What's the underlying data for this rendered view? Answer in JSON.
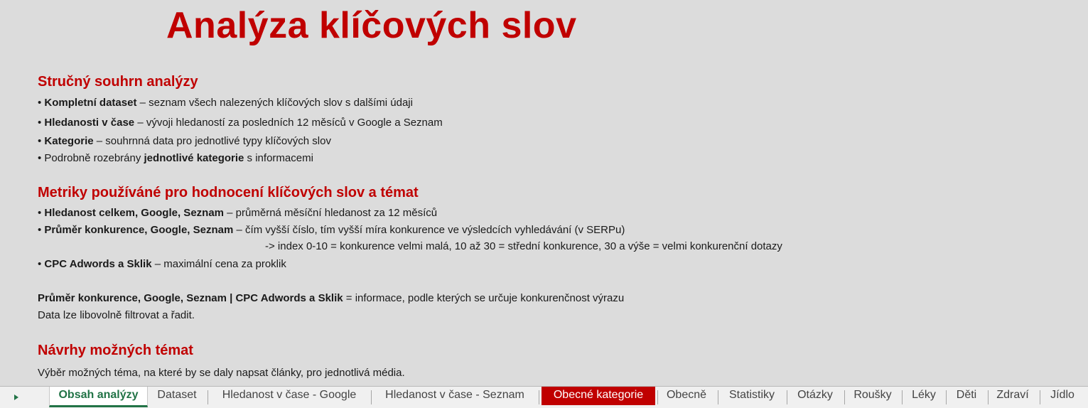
{
  "title": "Analýza klíčových slov",
  "section1": {
    "heading": "Stručný souhrn analýzy",
    "items": [
      {
        "bullet": "• ",
        "bold": "Kompletní dataset",
        "text": " – seznam všech nalezených klíčových slov s dalšími údaji"
      },
      {
        "bullet": "• ",
        "bold": "Hledanosti v čase",
        "text": " – vývoji hledaností za posledních 12 měsíců v Google a Seznam"
      },
      {
        "bullet": "• ",
        "bold": "Kategorie",
        "text": " – souhrnná data pro jednotlivé typy klíčových slov"
      },
      {
        "bullet": "• ",
        "pre": "Podrobně rozebrány ",
        "bold": "jednotlivé kategorie",
        "text": " s informacemi"
      }
    ]
  },
  "section2": {
    "heading": "Metriky používáné pro hodnocení klíčových slov a témat",
    "items": [
      {
        "bullet": "• ",
        "bold": "Hledanost celkem, Google, Seznam",
        "text": " – průměrná měsíční hledanost za 12 měsíců"
      },
      {
        "bullet": "• ",
        "bold": "Průměr konkurence, Google, Seznam",
        "text": " – čím vyšší číslo, tím vyšší míra konkurence ve výsledcích vyhledávání (v SERPu)"
      },
      {
        "bullet": "• ",
        "bold": "CPC Adwords a Sklik",
        "text": " – maximální cena za proklik"
      }
    ],
    "index_note": "-> index 0-10 = konkurence velmi malá, 10 až 30 = střední konkurence, 30 a výše = velmi konkurenční dotazy",
    "summary_bold": "Průměr konkurence, Google, Seznam | CPC Adwords a Sklik",
    "summary_text": " = informace, podle kterých se určuje konkurenčnost výrazu",
    "filter_note": "Data lze libovolně filtrovat a řadit."
  },
  "section3": {
    "heading": "Návrhy možných témat",
    "text": "Výběr možných téma, na které by se daly napsat články, pro jednotlivá média."
  },
  "tabs": [
    "Obsah analýzy",
    "Dataset",
    "Hledanost v čase - Google",
    "Hledanost v čase - Seznam",
    "Obecné kategorie",
    "Obecně",
    "Statistiky",
    "Otázky",
    "Roušky",
    "Léky",
    "Děti",
    "Zdraví",
    "Jídlo"
  ],
  "colors": {
    "accent_red": "#c00000",
    "active_tab": "#217346",
    "background": "#dcdcdc"
  },
  "icons": {
    "tab_scroll": "triangle-right"
  }
}
